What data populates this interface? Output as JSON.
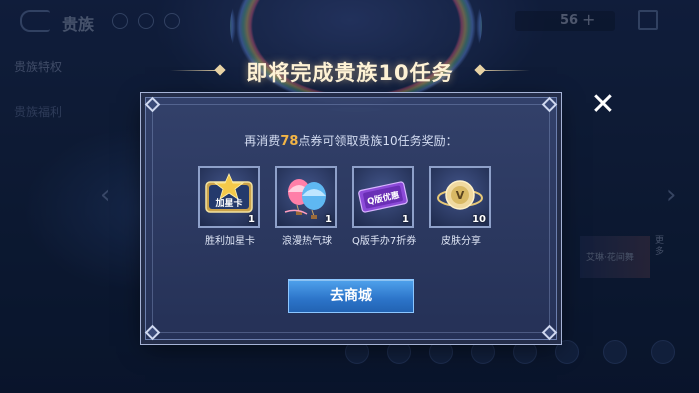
{
  "background": {
    "title": "贵族",
    "currency_count": "56",
    "sidebar_items": [
      "贵族特权",
      "贵族福利"
    ],
    "featured_label": "艾琳·花间舞",
    "more_label": "更多"
  },
  "dialog": {
    "title": "即将完成贵族10任务",
    "desc_prefix": "再消费",
    "desc_amount": "78",
    "desc_suffix": "点券可领取贵族10任务奖励：",
    "rewards": [
      {
        "name": "胜利加星卡",
        "count": "1",
        "icon": "star-card-icon",
        "art_text": "加星卡"
      },
      {
        "name": "浪漫热气球",
        "count": "1",
        "icon": "hot-air-balloon-icon"
      },
      {
        "name": "Q版手办7折券",
        "count": "1",
        "icon": "discount-coupon-icon",
        "art_text": "Q版优惠"
      },
      {
        "name": "皮肤分享",
        "count": "10",
        "icon": "skin-share-icon",
        "art_text": "V"
      }
    ],
    "button_label": "去商城",
    "close_icon": "close-icon"
  },
  "colors": {
    "highlight": "#f3b546",
    "button": "#2c74c9",
    "title": "#fff3d6"
  }
}
